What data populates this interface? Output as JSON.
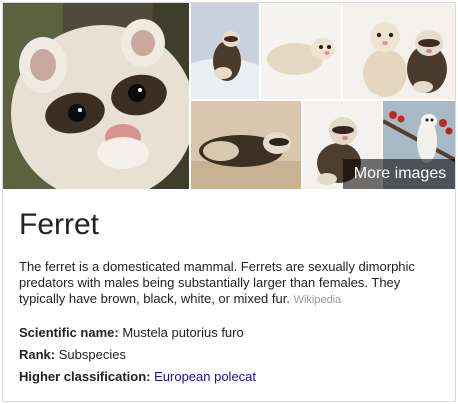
{
  "gallery": {
    "more_images_label": "More images",
    "images": [
      {
        "name": "ferret-closeup-photo",
        "subject": "ferret face close-up"
      },
      {
        "name": "ferret-in-snow-photo",
        "subject": "ferret in snow"
      },
      {
        "name": "white-ferret-photo",
        "subject": "white ferret on white"
      },
      {
        "name": "two-ferrets-photo",
        "subject": "two ferrets sitting"
      },
      {
        "name": "ferret-lying-photo",
        "subject": "ferret lying on tan blanket"
      },
      {
        "name": "ferret-sitting-photo",
        "subject": "ferret sitting"
      },
      {
        "name": "ferret-in-tree-photo",
        "subject": "white ferret among red berries"
      }
    ]
  },
  "entity": {
    "title": "Ferret",
    "description": "The ferret is a domesticated mammal. Ferrets are sexually dimorphic predators with males being substantially larger than females. They typically have brown, black, white, or mixed fur.",
    "source_label": "Wikipedia"
  },
  "facts": [
    {
      "label": "Scientific name:",
      "value": "Mustela putorius furo",
      "link": false
    },
    {
      "label": "Rank:",
      "value": "Subspecies",
      "link": false
    },
    {
      "label": "Higher classification:",
      "value": "European polecat",
      "link": true
    }
  ],
  "colors": {
    "link": "#1a0dab",
    "text": "#222222",
    "source": "#999999",
    "border": "#d9d9d9"
  }
}
